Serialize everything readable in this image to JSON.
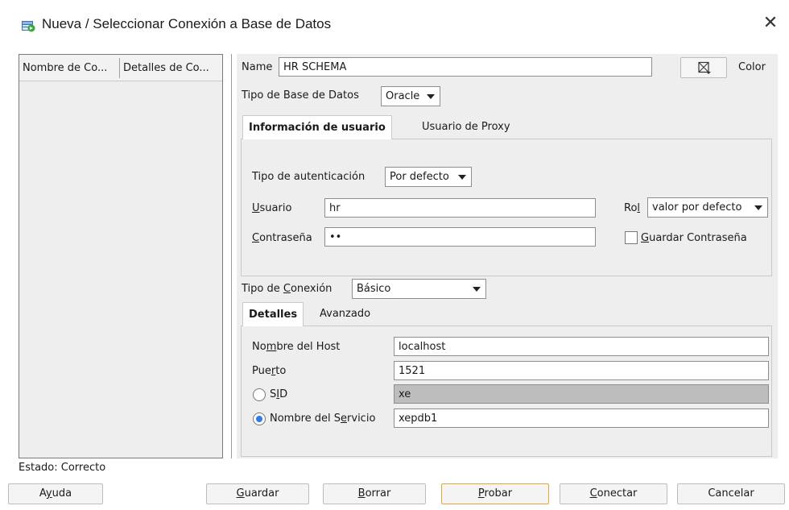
{
  "window": {
    "title": "Nueva / Seleccionar Conexión a Base de Datos",
    "close_glyph": "✕"
  },
  "connections_list": {
    "columns": [
      "Nombre de Co...",
      "Detalles de Co..."
    ]
  },
  "form": {
    "name_label": "Name",
    "name_value": "HR SCHEMA",
    "color_label": "Color",
    "db_type_label": "Tipo de Base de Datos",
    "db_type_value": "Oracle",
    "user_tabs": [
      "Información de usuario",
      "Usuario de Proxy"
    ],
    "auth_type_label": "Tipo de autenticación",
    "auth_type_value": "Por defecto",
    "user_label_u": "U",
    "user_label_rest": "suario",
    "user_value": "hr",
    "role_label_pre": "Ro",
    "role_label_u": "l",
    "role_value": "valor por defecto",
    "password_label_u": "C",
    "password_label_rest": "ontraseña",
    "password_value": "••",
    "save_password_u": "G",
    "save_password_rest": "uardar Contraseña",
    "conn_type_label_pre": "Tipo de ",
    "conn_type_label_u": "C",
    "conn_type_label_rest": "onexión",
    "conn_type_value": "Básico",
    "conn_tabs": [
      "Detalles",
      "Avanzado"
    ],
    "host_label_pre": "No",
    "host_label_u": "m",
    "host_label_rest": "bre del Host",
    "host_value": "localhost",
    "port_label_pre": "Pue",
    "port_label_u": "r",
    "port_label_rest": "to",
    "port_value": "1521",
    "sid_label_pre": "S",
    "sid_label_u": "I",
    "sid_label_rest": "D",
    "sid_value": "xe",
    "service_label_pre": "Nombre del S",
    "service_label_u": "e",
    "service_label_rest": "rvicio",
    "service_value": "xepdb1"
  },
  "status": "Estado: Correcto",
  "buttons": {
    "help_pre": "A",
    "help_u": "y",
    "help_rest": "uda",
    "save_u": "G",
    "save_rest": "uardar",
    "clear_u": "B",
    "clear_rest": "orrar",
    "test_u": "P",
    "test_rest": "robar",
    "connect_u": "C",
    "connect_rest": "onectar",
    "cancel": "Cancelar"
  },
  "colors": {
    "panel_bg": "#eeeeee",
    "radio_selected": "#2d7be5",
    "primary_button_border": "#e5a33f",
    "title_icon_green": "#3aa83a",
    "title_icon_blue": "#3c6fb6"
  },
  "icons": {
    "title": "database-connection-icon",
    "color_picker": "color-picker-icon"
  }
}
